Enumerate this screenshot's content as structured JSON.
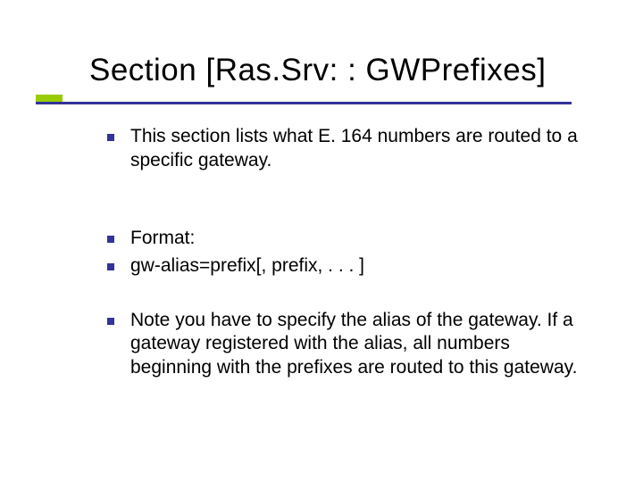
{
  "slide": {
    "title": "Section [Ras.Srv: : GWPrefixes]",
    "bullets": [
      "This section lists what E. 164 numbers are routed to a specific gateway.",
      "Format:",
      "gw-alias=prefix[, prefix, . . . ]",
      "Note you have to specify the alias of the gateway. If a gateway registered with the alias, all numbers beginning with the prefixes are routed to this gateway."
    ]
  },
  "colors": {
    "accent_bar": "#99cc00",
    "underline": "#333399",
    "bullet": "#333399"
  }
}
